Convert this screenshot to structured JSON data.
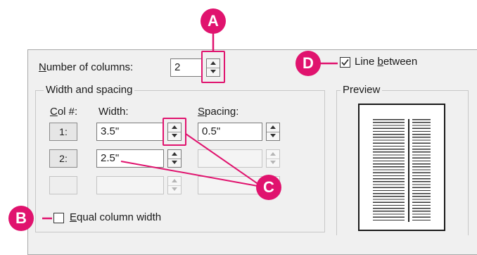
{
  "number_of_columns": {
    "label_u": "N",
    "label_rest": "umber of columns:",
    "value": "2"
  },
  "line_between": {
    "label_pre": "Line ",
    "label_u": "b",
    "label_post": "etween",
    "checked": true
  },
  "width_and_spacing": {
    "title": "Width and spacing",
    "col_header_u": "C",
    "col_header_rest": "ol #:",
    "width_header": "Width:",
    "spacing_header_u": "S",
    "spacing_header_rest": "pacing:",
    "rows": [
      {
        "col": "1:",
        "width": "3.5\"",
        "spacing": "0.5\""
      },
      {
        "col": "2:",
        "width": "2.5\"",
        "spacing": ""
      },
      {
        "col": "",
        "width": "",
        "spacing": ""
      }
    ]
  },
  "equal_column_width": {
    "label_u": "E",
    "label_rest": "qual column width",
    "checked": false
  },
  "preview": {
    "title": "Preview"
  },
  "callouts": {
    "a": "A",
    "b": "B",
    "c": "C",
    "d": "D"
  },
  "colors": {
    "accent": "#e0136e",
    "dialog_bg": "#f0f0f0"
  }
}
